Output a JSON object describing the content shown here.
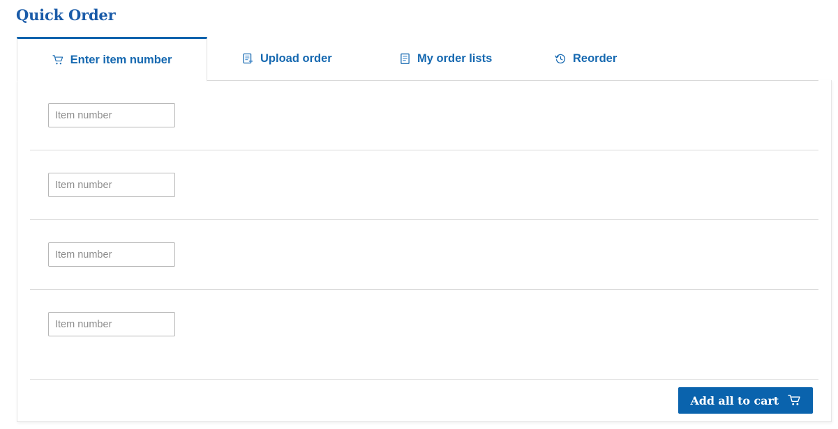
{
  "page": {
    "title": "Quick Order"
  },
  "tabs": [
    {
      "label": "Enter item number",
      "icon": "shopping-cart-icon",
      "active": true
    },
    {
      "label": "Upload order",
      "icon": "document-upload-icon",
      "active": false
    },
    {
      "label": "My order lists",
      "icon": "document-list-icon",
      "active": false
    },
    {
      "label": "Reorder",
      "icon": "history-clock-icon",
      "active": false
    }
  ],
  "item_rows": [
    {
      "value": "",
      "placeholder": "Item number"
    },
    {
      "value": "",
      "placeholder": "Item number"
    },
    {
      "value": "",
      "placeholder": "Item number"
    },
    {
      "value": "",
      "placeholder": "Item number"
    }
  ],
  "footer": {
    "add_all_label": "Add all to cart",
    "add_all_icon": "shopping-cart-icon"
  },
  "colors": {
    "brand_blue": "#0a63ad",
    "title_blue": "#1a5ba8",
    "tab_blue": "#1568b0",
    "border_gray": "#d8d8d8",
    "input_border": "#b7b7b7",
    "placeholder_gray": "#8d8d8d"
  }
}
